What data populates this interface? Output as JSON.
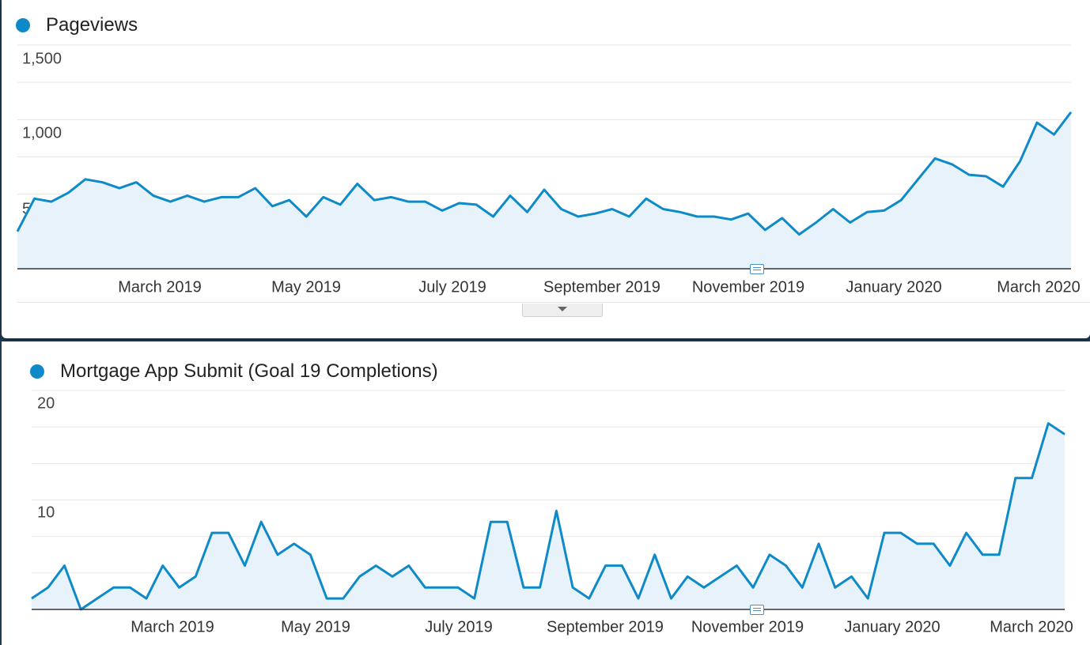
{
  "colors": {
    "series": "#0e8ac8",
    "fill": "#e8f2fa",
    "grid": "#e6e6e6",
    "axis": "#333333"
  },
  "chart_data": [
    {
      "type": "area",
      "series_name": "Pageviews",
      "ylim": [
        0,
        1500
      ],
      "yticks": [
        "1,500",
        "1,000",
        "500"
      ],
      "x_labels": [
        "March 2019",
        "May 2019",
        "July 2019",
        "September 2019",
        "November 2019",
        "January 2020",
        "March 2020"
      ],
      "x": [
        "2019-01-27",
        "2019-02-03",
        "2019-02-10",
        "2019-02-17",
        "2019-02-24",
        "2019-03-03",
        "2019-03-10",
        "2019-03-17",
        "2019-03-24",
        "2019-03-31",
        "2019-04-07",
        "2019-04-14",
        "2019-04-21",
        "2019-04-28",
        "2019-05-05",
        "2019-05-12",
        "2019-05-19",
        "2019-05-26",
        "2019-06-02",
        "2019-06-09",
        "2019-06-16",
        "2019-06-23",
        "2019-06-30",
        "2019-07-07",
        "2019-07-14",
        "2019-07-21",
        "2019-07-28",
        "2019-08-04",
        "2019-08-11",
        "2019-08-18",
        "2019-08-25",
        "2019-09-01",
        "2019-09-08",
        "2019-09-15",
        "2019-09-22",
        "2019-09-29",
        "2019-10-06",
        "2019-10-13",
        "2019-10-20",
        "2019-10-27",
        "2019-11-03",
        "2019-11-10",
        "2019-11-17",
        "2019-11-24",
        "2019-12-01",
        "2019-12-08",
        "2019-12-15",
        "2019-12-22",
        "2019-12-29",
        "2020-01-05",
        "2020-01-12",
        "2020-01-19",
        "2020-01-26",
        "2020-02-02",
        "2020-02-09",
        "2020-02-16",
        "2020-02-23",
        "2020-03-01",
        "2020-03-08",
        "2020-03-15",
        "2020-03-22"
      ],
      "values": [
        250,
        470,
        450,
        510,
        600,
        580,
        540,
        580,
        490,
        450,
        490,
        450,
        480,
        480,
        540,
        420,
        460,
        350,
        480,
        430,
        570,
        460,
        480,
        450,
        450,
        390,
        440,
        430,
        350,
        490,
        380,
        530,
        400,
        350,
        370,
        400,
        350,
        470,
        400,
        380,
        350,
        350,
        330,
        370,
        260,
        340,
        230,
        310,
        400,
        310,
        380,
        390,
        460,
        600,
        740,
        700,
        630,
        620,
        550,
        720,
        980,
        900,
        1050
      ]
    },
    {
      "type": "area",
      "series_name": "Mortgage App Submit (Goal 19 Completions)",
      "ylim": [
        0,
        20
      ],
      "yticks": [
        "20",
        "10"
      ],
      "x_labels": [
        "March 2019",
        "May 2019",
        "July 2019",
        "September 2019",
        "November 2019",
        "January 2020",
        "March 2020"
      ],
      "values": [
        1,
        2,
        4,
        0,
        1,
        2,
        2,
        1,
        4,
        2,
        3,
        7,
        7,
        4,
        8,
        5,
        6,
        5,
        1,
        1,
        3,
        4,
        3,
        4,
        2,
        2,
        2,
        1,
        8,
        8,
        2,
        2,
        9,
        2,
        1,
        4,
        4,
        1,
        5,
        1,
        3,
        2,
        3,
        4,
        2,
        5,
        4,
        2,
        6,
        2,
        3,
        1,
        7,
        7,
        6,
        6,
        4,
        7,
        5,
        5,
        12,
        12,
        17,
        16
      ]
    }
  ]
}
